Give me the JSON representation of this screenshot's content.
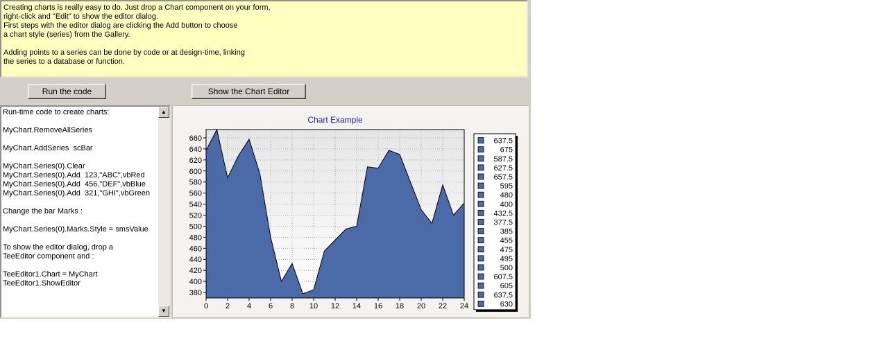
{
  "intro": {
    "text": "Creating charts is really easy to do. Just drop a Chart component on your form,\nright-click and \"Edit\" to show the editor dialog.\nFirst steps with the editor dialog are clicking the Add button to choose\na chart style (series) from the Gallery.\n\nAdding points to a series can be done by code or at design-time, linking\nthe series to a database or function."
  },
  "buttons": {
    "run_code": "Run the code",
    "show_editor": "Show the Chart Editor"
  },
  "code_panel": {
    "text": "Run-time code to create charts:\n\nMyChart.RemoveAllSeries\n\nMyChart.AddSeries  scBar\n\nMyChart.Series(0).Clear\nMyChart.Series(0).Add  123,\"ABC\",vbRed\nMyChart.Series(0).Add  456,\"DEF\",vbBlue\nMyChart.Series(0).Add  321,\"GHI\",vbGreen\n\nChange the bar Marks :\n\nMyChart.Series(0).Marks.Style = smsValue\n\nTo show the editor dialog, drop a\nTeeEditor component and :\n\nTeeEditor1.Chart = MyChart\nTeeEditor1.ShowEditor"
  },
  "chart_data": {
    "type": "area",
    "title": "Chart Example",
    "x": [
      0,
      1,
      2,
      3,
      4,
      5,
      6,
      7,
      8,
      9,
      10,
      11,
      12,
      13,
      14,
      15,
      16,
      17,
      18,
      19,
      20,
      21,
      22,
      23,
      24
    ],
    "values": [
      637.5,
      675,
      587.5,
      627.5,
      657.5,
      595,
      480,
      400,
      432.5,
      377.5,
      385,
      455,
      475,
      495,
      500,
      607.5,
      605,
      637.5,
      630,
      580,
      530,
      505,
      575,
      520,
      542
    ],
    "legend_labels": [
      "637.5",
      "675",
      "587.5",
      "627.5",
      "657.5",
      "595",
      "480",
      "400",
      "432.5",
      "377.5",
      "385",
      "455",
      "475",
      "495",
      "500",
      "607.5",
      "605",
      "637.5",
      "630"
    ],
    "xlim": [
      0,
      24
    ],
    "ylim": [
      370,
      675
    ],
    "xticks": [
      0,
      2,
      4,
      6,
      8,
      10,
      12,
      14,
      16,
      18,
      20,
      22,
      24
    ],
    "yticks": [
      380,
      400,
      420,
      440,
      460,
      480,
      500,
      520,
      540,
      560,
      580,
      600,
      620,
      640,
      660
    ],
    "grid": true,
    "legend_position": "right",
    "colors": {
      "fill": "#4a6aa8",
      "line": "#000000",
      "title": "#1a1acc"
    }
  }
}
